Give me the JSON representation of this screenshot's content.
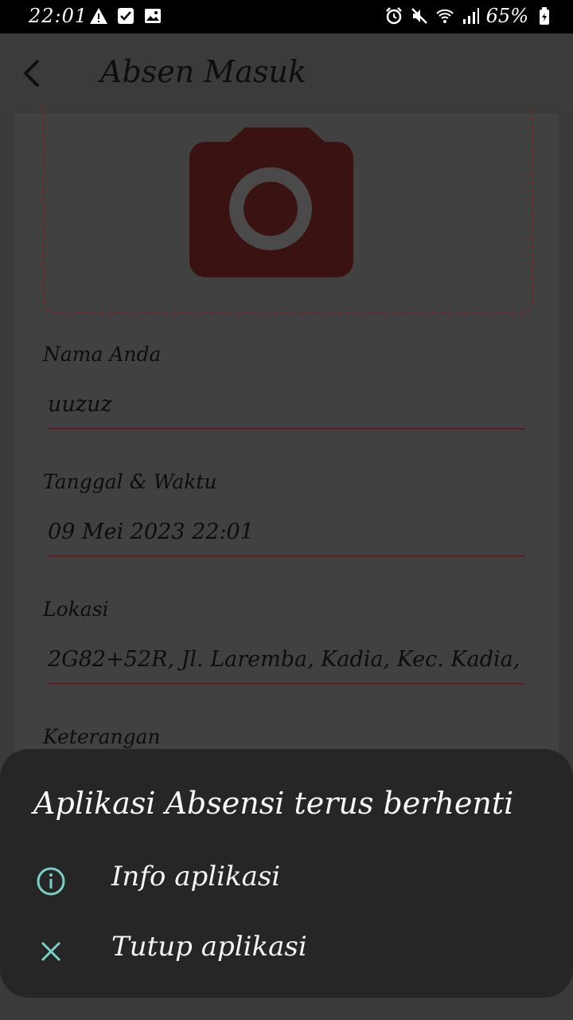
{
  "status_bar": {
    "time": "22:01",
    "battery": "65%",
    "left_icons": [
      "warning-icon",
      "checkbox-icon",
      "image-icon"
    ],
    "right_icons": [
      "alarm-icon",
      "mute-icon",
      "wifi-icon",
      "signal-icon",
      "battery-icon"
    ]
  },
  "app_bar": {
    "back_icon": "chevron-left-icon",
    "title": "Absen Masuk"
  },
  "form": {
    "photo_icon": "camera-icon",
    "name_label": "Nama Anda",
    "name_value": "uuzuz",
    "datetime_label": "Tanggal & Waktu",
    "datetime_value": "09 Mei 2023 22:01",
    "location_label": "Lokasi",
    "location_value": "2G82+52R, Jl. Laremba, Kadia, Kec. Kadia,",
    "notes_label": "Keterangan"
  },
  "dialog": {
    "title": "Aplikasi Absensi terus berhenti",
    "items": [
      {
        "icon": "info-icon",
        "label": "Info aplikasi"
      },
      {
        "icon": "close-icon",
        "label": "Tutup aplikasi"
      }
    ]
  },
  "colors": {
    "accent": "#7ad0c7",
    "camera": "#3a1212",
    "underline": "#5a1f1f"
  }
}
